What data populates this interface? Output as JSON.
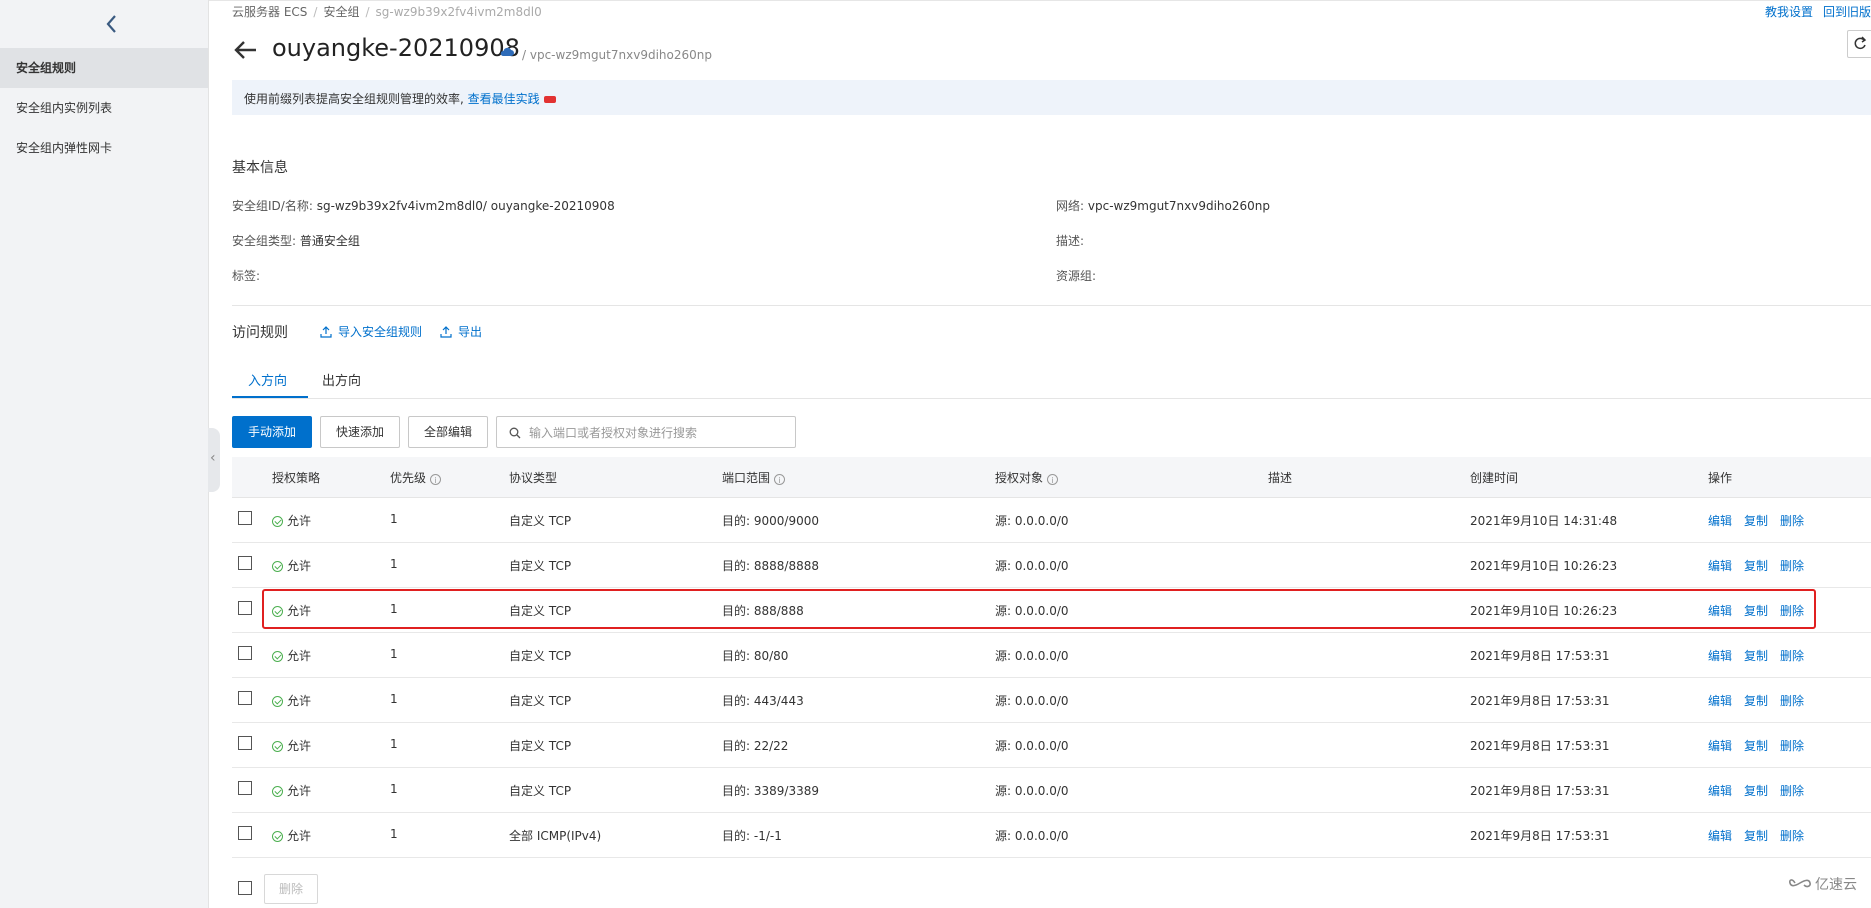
{
  "sidebar": {
    "items": [
      {
        "label": "安全组规则",
        "active": true
      },
      {
        "label": "安全组内实例列表",
        "active": false
      },
      {
        "label": "安全组内弹性网卡",
        "active": false
      }
    ]
  },
  "breadcrumb": {
    "items": [
      "云服务器 ECS",
      "安全组"
    ],
    "current": "sg-wz9b39x2fv4ivm2m8dl0"
  },
  "top_links": [
    "教我设置",
    "回到旧版"
  ],
  "header": {
    "title": "ouyangke-20210908",
    "vpc": "/ vpc-wz9mgut7nxv9diho260np"
  },
  "notice": {
    "text": "使用前缀列表提高安全组规则管理的效率,",
    "link": "查看最佳实践"
  },
  "basic_info": {
    "title": "基本信息",
    "id_name_label": "安全组ID/名称:",
    "id_name_value": "sg-wz9b39x2fv4ivm2m8dl0/ ouyangke-20210908",
    "type_label": "安全组类型:",
    "type_value": "普通安全组",
    "tags_label": "标签:",
    "network_label": "网络:",
    "network_value": "vpc-wz9mgut7nxv9diho260np",
    "desc_label": "描述:",
    "resource_group_label": "资源组:"
  },
  "rules": {
    "title": "访问规则",
    "import_label": "导入安全组规则",
    "export_label": "导出",
    "tabs": [
      "入方向",
      "出方向"
    ],
    "buttons": {
      "manual_add": "手动添加",
      "quick_add": "快速添加",
      "edit_all": "全部编辑"
    },
    "search_placeholder": "输入端口或者授权对象进行搜索",
    "columns": [
      "授权策略",
      "优先级",
      "协议类型",
      "端口范围",
      "授权对象",
      "描述",
      "创建时间",
      "操作"
    ],
    "row_actions": [
      "编辑",
      "复制",
      "删除"
    ],
    "rows": [
      {
        "policy": "允许",
        "priority": "1",
        "protocol": "自定义 TCP",
        "port": "目的: 9000/9000",
        "target": "源: 0.0.0.0/0",
        "desc": "",
        "time": "2021年9月10日 14:31:48"
      },
      {
        "policy": "允许",
        "priority": "1",
        "protocol": "自定义 TCP",
        "port": "目的: 8888/8888",
        "target": "源: 0.0.0.0/0",
        "desc": "",
        "time": "2021年9月10日 10:26:23"
      },
      {
        "policy": "允许",
        "priority": "1",
        "protocol": "自定义 TCP",
        "port": "目的: 888/888",
        "target": "源: 0.0.0.0/0",
        "desc": "",
        "time": "2021年9月10日 10:26:23"
      },
      {
        "policy": "允许",
        "priority": "1",
        "protocol": "自定义 TCP",
        "port": "目的: 80/80",
        "target": "源: 0.0.0.0/0",
        "desc": "",
        "time": "2021年9月8日 17:53:31"
      },
      {
        "policy": "允许",
        "priority": "1",
        "protocol": "自定义 TCP",
        "port": "目的: 443/443",
        "target": "源: 0.0.0.0/0",
        "desc": "",
        "time": "2021年9月8日 17:53:31"
      },
      {
        "policy": "允许",
        "priority": "1",
        "protocol": "自定义 TCP",
        "port": "目的: 22/22",
        "target": "源: 0.0.0.0/0",
        "desc": "",
        "time": "2021年9月8日 17:53:31"
      },
      {
        "policy": "允许",
        "priority": "1",
        "protocol": "自定义 TCP",
        "port": "目的: 3389/3389",
        "target": "源: 0.0.0.0/0",
        "desc": "",
        "time": "2021年9月8日 17:53:31"
      },
      {
        "policy": "允许",
        "priority": "1",
        "protocol": "全部 ICMP(IPv4)",
        "port": "目的: -1/-1",
        "target": "源: 0.0.0.0/0",
        "desc": "",
        "time": "2021年9月8日 17:53:31"
      }
    ],
    "footer_delete": "删除"
  },
  "watermark": "亿速云",
  "colors": {
    "accent": "#0070cc",
    "allow": "#4caf50",
    "highlight": "#e02020",
    "notice_bg": "#eef3fa"
  }
}
